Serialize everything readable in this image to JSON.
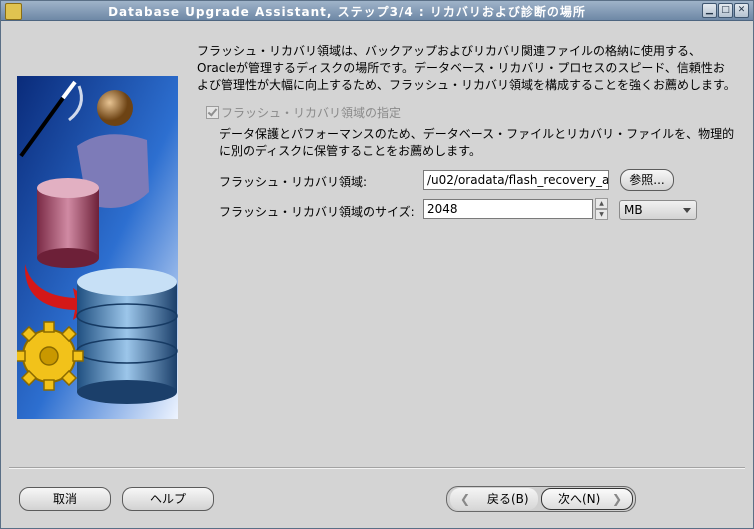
{
  "window": {
    "title": "Database Upgrade Assistant, ステップ3/4 : リカバリおよび診断の場所",
    "controls": [
      "minimize",
      "maximize",
      "close"
    ]
  },
  "intro_text_lines": [
    "フラッシュ・リカバリ領域は、バックアップおよびリカバリ関連ファイルの格納に使用する、",
    "Oracleが管理するディスクの場所です。データベース・リカバリ・プロセスのスピード、信頼性お",
    "よび管理性が大幅に向上するため、フラッシュ・リカバリ領域を構成することを強くお薦めします。"
  ],
  "specify_checkbox": {
    "label": "フラッシュ・リカバリ領域の指定",
    "checked": true,
    "enabled": false
  },
  "desc_lines": [
    "データ保護とパフォーマンスのため、データベース・ファイルとリカバリ・ファイルを、物理的",
    "に別のディスクに保管することをお薦めします。"
  ],
  "flash_area": {
    "label": "フラッシュ・リカバリ領域:",
    "value": "/u02/oradata/flash_recovery_a",
    "browse_label": "参照..."
  },
  "flash_size": {
    "label": "フラッシュ・リカバリ領域のサイズ:",
    "value": "2048",
    "unit": "MB"
  },
  "buttons": {
    "cancel": "取消",
    "help": "ヘルプ",
    "back": "戻る(B)",
    "next": "次へ(N)"
  },
  "icons": [
    "app-icon",
    "wand-icon",
    "user-silhouette-icon",
    "database-pink-icon",
    "database-blue-icon",
    "arrow-icon",
    "gear-icon",
    "chevron-left-icon",
    "chevron-right-icon",
    "spin-up-icon",
    "spin-down-icon",
    "dropdown-arrow-icon"
  ]
}
